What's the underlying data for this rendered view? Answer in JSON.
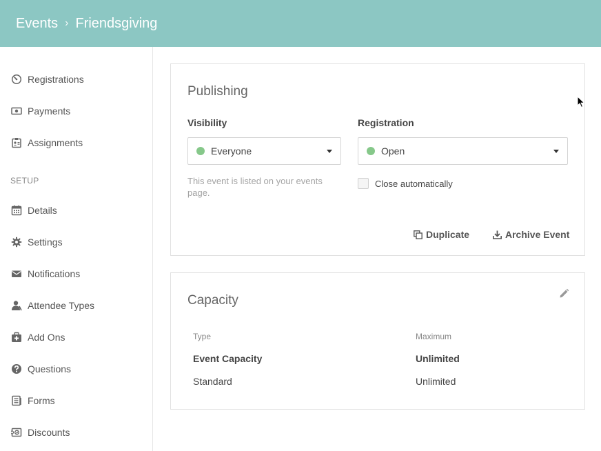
{
  "breadcrumb": {
    "root": "Events",
    "separator": "›",
    "current": "Friendsgiving"
  },
  "sidebar": {
    "items": [
      {
        "label": "Registrations",
        "icon": "gauge-icon"
      },
      {
        "label": "Payments",
        "icon": "money-icon"
      },
      {
        "label": "Assignments",
        "icon": "badge-icon"
      }
    ],
    "setup_label": "SETUP",
    "setup_items": [
      {
        "label": "Details",
        "icon": "calendar-icon"
      },
      {
        "label": "Settings",
        "icon": "gear-icon"
      },
      {
        "label": "Notifications",
        "icon": "envelope-icon"
      },
      {
        "label": "Attendee Types",
        "icon": "user-icon"
      },
      {
        "label": "Add Ons",
        "icon": "medkit-icon"
      },
      {
        "label": "Questions",
        "icon": "question-icon"
      },
      {
        "label": "Forms",
        "icon": "forms-icon"
      },
      {
        "label": "Discounts",
        "icon": "coupon-icon"
      }
    ]
  },
  "publishing": {
    "title": "Publishing",
    "visibility_label": "Visibility",
    "visibility_value": "Everyone",
    "visibility_help": "This event is listed on your events page.",
    "registration_label": "Registration",
    "registration_value": "Open",
    "close_auto_label": "Close automatically",
    "close_auto_checked": false,
    "duplicate_label": "Duplicate",
    "archive_label": "Archive Event",
    "status_color": "#86c88a"
  },
  "capacity": {
    "title": "Capacity",
    "columns": [
      "Type",
      "Maximum"
    ],
    "rows": [
      {
        "type": "Event Capacity",
        "maximum": "Unlimited",
        "bold": true
      },
      {
        "type": "Standard",
        "maximum": "Unlimited",
        "bold": false
      }
    ]
  },
  "colors": {
    "header": "#8cc7c3",
    "status_dot": "#86c88a"
  }
}
